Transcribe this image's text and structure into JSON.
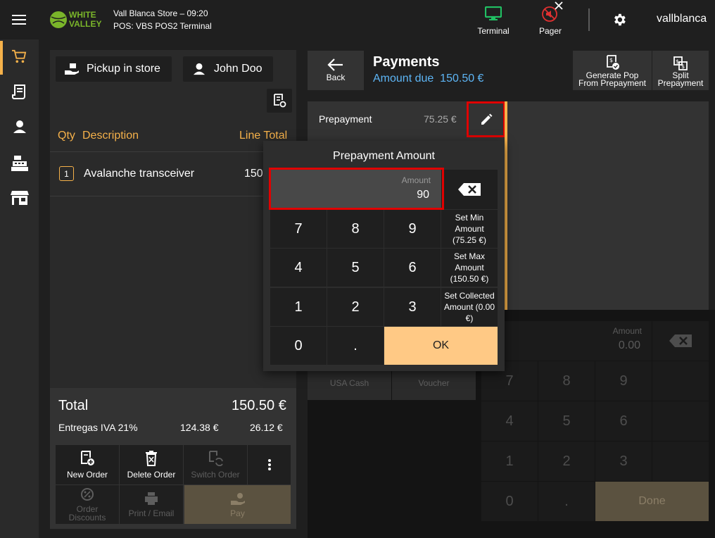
{
  "app": {
    "logo_line1": "WHITE",
    "logo_line2": "VALLEY",
    "store_info": "Vall Blanca Store – 09:20",
    "terminal_info": "POS: VBS POS2 Terminal",
    "user": "vallblanca"
  },
  "topbar": {
    "terminal_label": "Terminal",
    "pager_label": "Pager"
  },
  "order": {
    "pickup_label": "Pickup in store",
    "customer_label": "John Doo",
    "columns": {
      "qty": "Qty",
      "description": "Description",
      "line_total": "Line Total"
    },
    "lines": [
      {
        "qty": "1",
        "description": "Avalanche transceiver",
        "total": "150"
      }
    ],
    "total_label": "Total",
    "total_value": "150.50 €",
    "tax_label": "Entregas IVA 21%",
    "tax_base": "124.38 €",
    "tax_amount": "26.12 €",
    "actions": {
      "new_order": "New Order",
      "delete_order": "Delete Order",
      "switch_order": "Switch Order",
      "order_discounts": "Order Discounts",
      "print_email": "Print / Email",
      "pay": "Pay"
    }
  },
  "payments": {
    "back_label": "Back",
    "title": "Payments",
    "amount_due_label": "Amount due",
    "amount_due_value": "150.50 €",
    "generate_pop_label": "Generate Pop From Prepayment",
    "split_label": "Split Prepayment",
    "prepayment_label": "Prepayment",
    "prepayment_value": "75.25 €",
    "methods": {
      "usa_cash": "USA Cash",
      "voucher": "Voucher"
    },
    "amount_label": "Amount",
    "amount_value": "0.00",
    "keys": [
      "7",
      "8",
      "9",
      "4",
      "5",
      "6",
      "1",
      "2",
      "3",
      "0",
      "."
    ],
    "done_label": "Done"
  },
  "dialog": {
    "title": "Prepayment Amount",
    "amount_label": "Amount",
    "amount_value": "90",
    "keys": [
      "7",
      "8",
      "9",
      "4",
      "5",
      "6",
      "1",
      "2",
      "3",
      "0",
      "."
    ],
    "set_min": "Set Min Amount (75.25 €)",
    "set_max": "Set Max Amount (150.50 €)",
    "set_collected": "Set Collected Amount (0.00 €)",
    "ok_label": "OK"
  },
  "colors": {
    "accent": "#f5b14a",
    "ok_button": "#ffc985",
    "highlight": "#e00000",
    "link": "#5db5f5",
    "terminal_icon": "#21c063",
    "pager_icon": "#e03030"
  }
}
